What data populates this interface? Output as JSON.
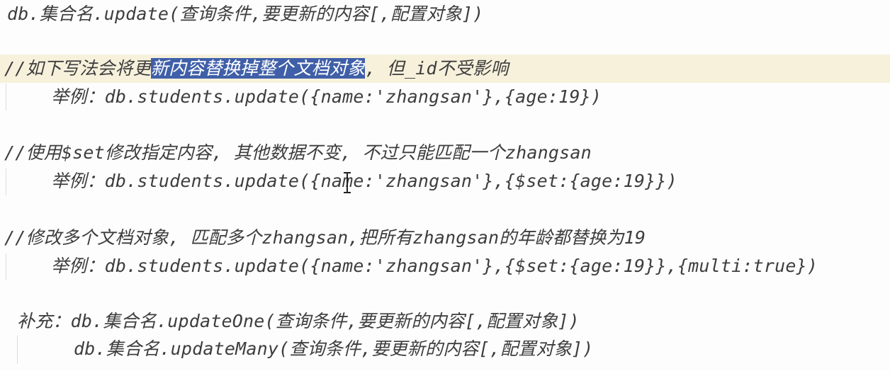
{
  "lines": {
    "syntax": "db.集合名.update(查询条件,要更新的内容[,配置对象])",
    "comment1_pre": "//如下写法会将更",
    "comment1_sel": "新内容替换掉整个文档对象",
    "comment1_post": ", 但_id不受影响",
    "example1": "举例：db.students.update({name:'zhangsan'},{age:19})",
    "comment2": "//使用$set修改指定内容, 其他数据不变, 不过只能匹配一个zhangsan",
    "example2_pre": "举例：db.students.update(",
    "example2_post": "{name:'zhangsan'},{$set:{age:19}})",
    "comment3": "//修改多个文档对象, 匹配多个zhangsan,把所有zhangsan的年龄都替换为19",
    "example3": "举例：db.students.update({name:'zhangsan'},{$set:{age:19}},{multi:true})",
    "supplement1": "补充：db.集合名.updateOne(查询条件,要更新的内容[,配置对象])",
    "supplement2": "db.集合名.updateMany(查询条件,要更新的内容[,配置对象])"
  },
  "colors": {
    "background": "#fdfdfd",
    "text": "#3d3d3d",
    "selection": "#3f5fa8",
    "current_line": "#f7f1dc"
  }
}
